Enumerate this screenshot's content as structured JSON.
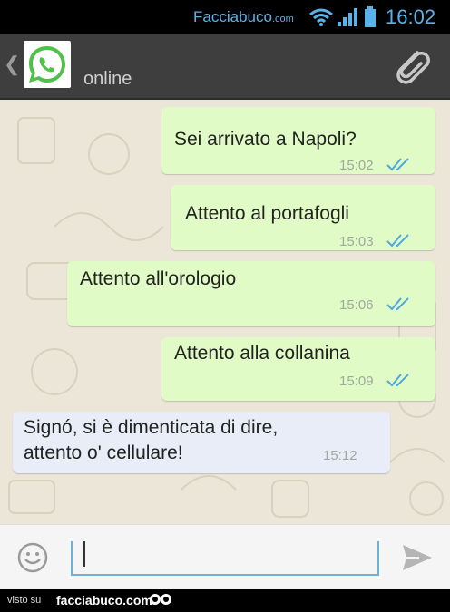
{
  "status_bar": {
    "brand": "Facciabuco",
    "brand_domain": ".com",
    "time": "16:02",
    "icons": [
      "wifi-icon",
      "signal-icon",
      "battery-icon"
    ]
  },
  "header": {
    "status": "online",
    "icons": [
      "back-chevron-icon",
      "whatsapp-avatar-icon",
      "paperclip-icon"
    ]
  },
  "messages": [
    {
      "direction": "out",
      "text": "Sei arrivato a Napoli?",
      "time": "15:02",
      "read": true
    },
    {
      "direction": "out",
      "text": "Attento al portafogli",
      "time": "15:03",
      "read": true
    },
    {
      "direction": "out",
      "text": "Attento all'orologio",
      "time": "15:06",
      "read": true
    },
    {
      "direction": "out",
      "text": "Attento alla collanina",
      "time": "15:09",
      "read": true
    },
    {
      "direction": "in",
      "text": "Signó, si è dimenticata di dire,\nattento o' cellulare!",
      "time": "15:12"
    }
  ],
  "input": {
    "value": "",
    "icons": [
      "emoji-icon",
      "send-icon"
    ]
  },
  "footer": {
    "visto": "visto su",
    "site": "facciabuco.com"
  },
  "colors": {
    "outgoing_bubble": "#e1fbc6",
    "incoming_bubble": "#e9edf7",
    "read_ticks": "#4fa8e0",
    "brand": "#5ab3e8"
  }
}
